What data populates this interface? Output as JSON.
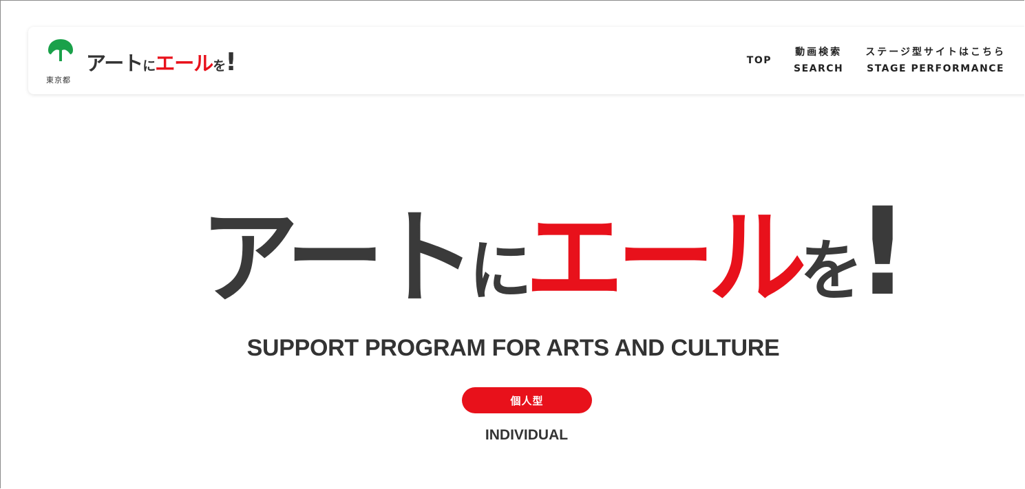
{
  "header": {
    "logo": {
      "city": "東京都",
      "title": {
        "part1": "アート",
        "part2": "に",
        "part3": "エール",
        "part4": "を",
        "part5": "!"
      }
    },
    "nav": [
      {
        "jp": "",
        "en": "TOP"
      },
      {
        "jp": "動画検索",
        "en": "SEARCH"
      },
      {
        "jp": "ステージ型サイトはこちら",
        "en": "STAGE PERFORMANCE"
      }
    ]
  },
  "hero": {
    "title": {
      "part1": "アート",
      "part2": "に",
      "part3": "エール",
      "part4": "を",
      "part5": "!"
    },
    "subtitle": "SUPPORT PROGRAM FOR ARTS AND CULTURE",
    "badge": {
      "label": "個人型",
      "en": "INDIVIDUAL"
    }
  },
  "colors": {
    "accent": "#e8111b",
    "text": "#333333",
    "logo_green": "#1aa14a"
  },
  "icons": {
    "logo_mark": "tokyo-ginkgo-icon"
  }
}
